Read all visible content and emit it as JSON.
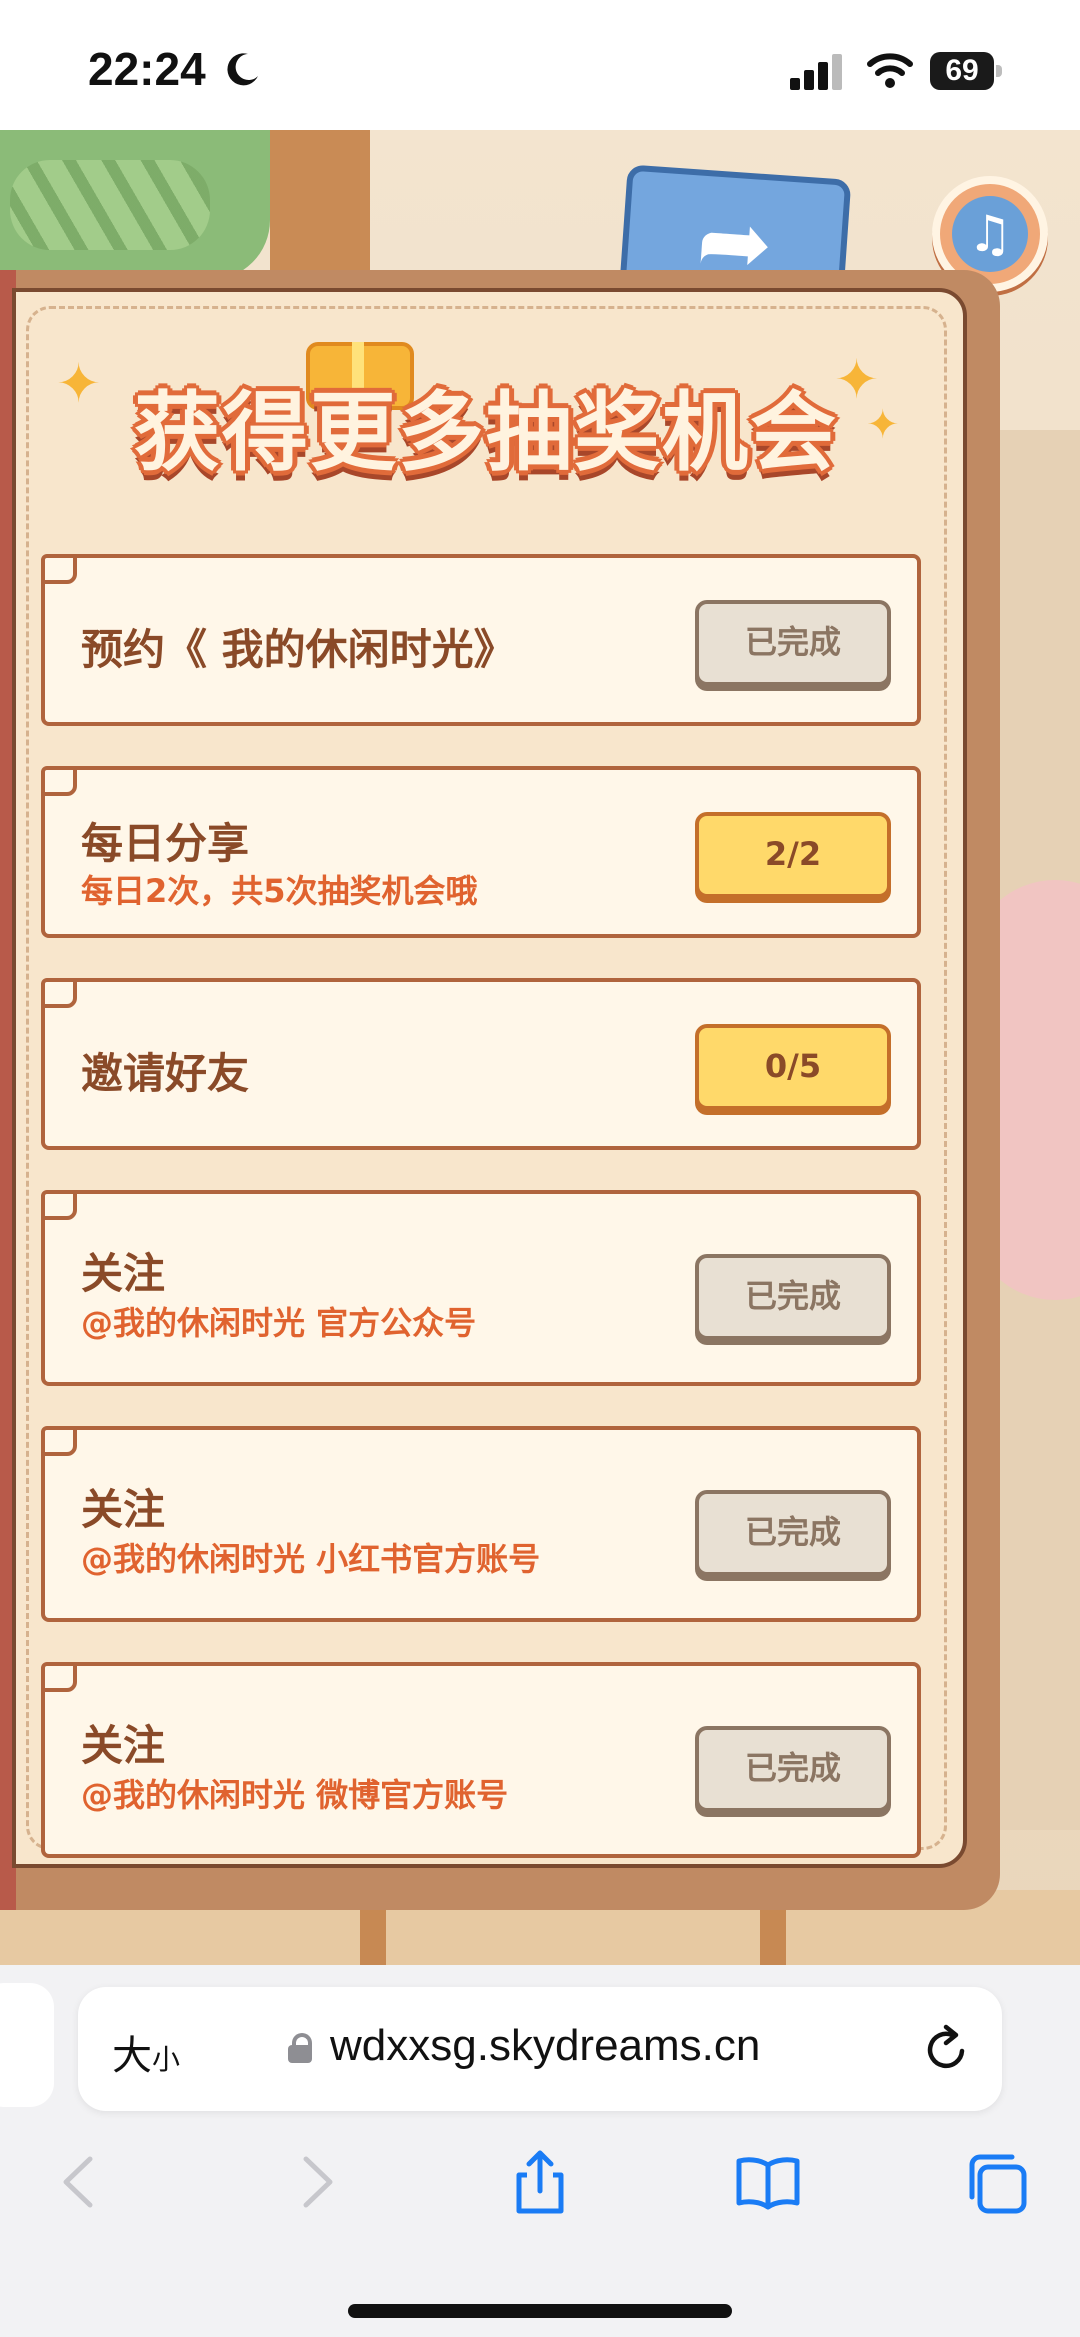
{
  "status_bar": {
    "time": "22:24",
    "battery": "69"
  },
  "game": {
    "title": "获得更多抽奖机会",
    "music_icon": "music-note-icon",
    "share_icon": "share-arrow-icon",
    "tasks": [
      {
        "name": "预约《 我的休闲时光》",
        "sub": "",
        "button": "已完成",
        "state": "done"
      },
      {
        "name": "每日分享",
        "sub": "每日2次，共5次抽奖机会哦",
        "button": "2/2",
        "state": "progress"
      },
      {
        "name": "邀请好友",
        "sub": "",
        "button": "0/5",
        "state": "progress"
      },
      {
        "name": "关注",
        "sub": "@我的休闲时光 官方公众号",
        "button": "已完成",
        "state": "done"
      },
      {
        "name": "关注",
        "sub": "@我的休闲时光 小红书官方账号",
        "button": "已完成",
        "state": "done"
      },
      {
        "name": "关注",
        "sub": "@我的休闲时光 微博官方账号",
        "button": "已完成",
        "state": "done"
      }
    ]
  },
  "browser": {
    "text_size_label": "大",
    "text_size_small": "小",
    "url": "wdxxsg.skydreams.cn"
  },
  "colors": {
    "accent_orange": "#e0632f",
    "safari_blue": "#1a7cf5"
  }
}
